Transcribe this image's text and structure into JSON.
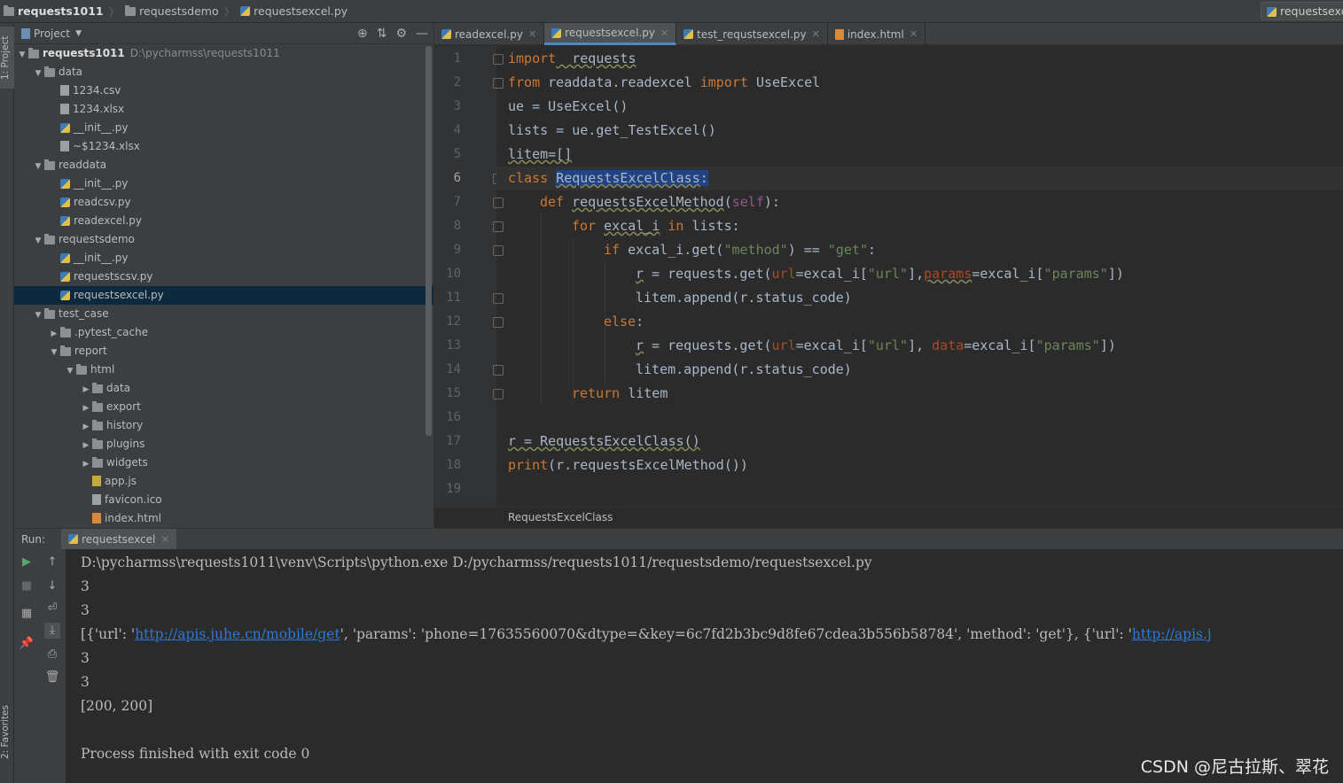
{
  "breadcrumb": [
    "requests1011",
    "requestsdemo",
    "requestsexcel.py"
  ],
  "run_config": "requestsexcel",
  "left_tool": {
    "project": "1: Project",
    "favorites": "2: Favorites"
  },
  "project_panel": {
    "title": "Project",
    "root": {
      "name": "requests1011",
      "path": "D:\\pycharmss\\requests1011"
    },
    "items": [
      {
        "label": "data",
        "icon": "folder-icon"
      },
      {
        "label": "1234.csv",
        "icon": "file-icon"
      },
      {
        "label": "1234.xlsx",
        "icon": "file-icon"
      },
      {
        "label": "__init__.py",
        "icon": "python-file-icon"
      },
      {
        "label": "~$1234.xlsx",
        "icon": "file-icon"
      },
      {
        "label": "readdata",
        "icon": "folder-icon"
      },
      {
        "label": "__init__.py",
        "icon": "python-file-icon"
      },
      {
        "label": "readcsv.py",
        "icon": "python-file-icon"
      },
      {
        "label": "readexcel.py",
        "icon": "python-file-icon"
      },
      {
        "label": "requestsdemo",
        "icon": "folder-icon"
      },
      {
        "label": "__init__.py",
        "icon": "python-file-icon"
      },
      {
        "label": "requestscsv.py",
        "icon": "python-file-icon"
      },
      {
        "label": "requestsexcel.py",
        "icon": "python-file-icon"
      },
      {
        "label": "test_case",
        "icon": "folder-icon"
      },
      {
        "label": ".pytest_cache",
        "icon": "folder-icon"
      },
      {
        "label": "report",
        "icon": "folder-icon"
      },
      {
        "label": "html",
        "icon": "folder-icon"
      },
      {
        "label": "data",
        "icon": "folder-icon"
      },
      {
        "label": "export",
        "icon": "folder-icon"
      },
      {
        "label": "history",
        "icon": "folder-icon"
      },
      {
        "label": "plugins",
        "icon": "folder-icon"
      },
      {
        "label": "widgets",
        "icon": "folder-icon"
      },
      {
        "label": "app.js",
        "icon": "js-file-icon"
      },
      {
        "label": "favicon.ico",
        "icon": "file-icon"
      },
      {
        "label": "index.html",
        "icon": "html-file-icon"
      }
    ]
  },
  "editor_tabs": [
    {
      "label": "readexcel.py",
      "icon": "python-file-icon"
    },
    {
      "label": "requestsexcel.py",
      "icon": "python-file-icon"
    },
    {
      "label": "test_requstsexcel.py",
      "icon": "python-file-icon"
    },
    {
      "label": "index.html",
      "icon": "html-file-icon"
    }
  ],
  "line_numbers": [
    "1",
    "2",
    "3",
    "4",
    "5",
    "6",
    "7",
    "8",
    "9",
    "10",
    "11",
    "12",
    "13",
    "14",
    "15",
    "16",
    "17",
    "18",
    "19"
  ],
  "code": {
    "l1": [
      "import",
      "  requests"
    ],
    "l2": [
      "from",
      " readdata.readexcel ",
      "import",
      " UseExcel"
    ],
    "l3": "ue = UseExcel()",
    "l4": "lists = ue.get_TestExcel()",
    "l5": "litem=[]",
    "l6": [
      "class",
      " ",
      "RequestsExcelClass",
      ":"
    ],
    "l7": [
      "def",
      " ",
      "requestsExcelMethod",
      "(",
      "self",
      "):"
    ],
    "l8": [
      "for",
      " ",
      "excal_i",
      " ",
      "in",
      " lists:"
    ],
    "l9": [
      "if",
      " excal_i.get(",
      "\"method\"",
      ") == ",
      "\"get\"",
      ":"
    ],
    "l10": [
      "r",
      " = requests.get(",
      "url",
      "=excal_i[",
      "\"url\"",
      "],",
      "params",
      "=excal_i[",
      "\"params\"",
      "])"
    ],
    "l11": "litem.append(r.status_code)",
    "l12": [
      "else",
      ":"
    ],
    "l13": [
      "r",
      " = requests.get(",
      "url",
      "=excal_i[",
      "\"url\"",
      "], ",
      "data",
      "=excal_i[",
      "\"params\"",
      "])"
    ],
    "l14": "litem.append(r.status_code)",
    "l15": [
      "return",
      " litem"
    ],
    "l17": "r = RequestsExcelClass()",
    "l18": [
      "print",
      "(r.requestsExcelMethod())"
    ]
  },
  "editor_breadcrumb": "RequestsExcelClass",
  "run": {
    "label": "Run:",
    "tab": "requestsexcel",
    "console": [
      "D:\\pycharmss\\requests1011\\venv\\Scripts\\python.exe D:/pycharmss/requests1011/requestsdemo/requestsexcel.py",
      "3",
      "3",
      [
        "[{'url': '",
        "http://apis.juhe.cn/mobile/get",
        "', 'params': 'phone=17635560070&dtype=&key=6c7fd2b3bc9d8fe67cdea3b556b58784', 'method': 'get'}, {'url': '",
        "http://apis.j"
      ],
      "3",
      "3",
      "[200, 200]",
      "",
      "Process finished with exit code 0"
    ]
  },
  "watermark": "CSDN @尼古拉斯、翠花"
}
